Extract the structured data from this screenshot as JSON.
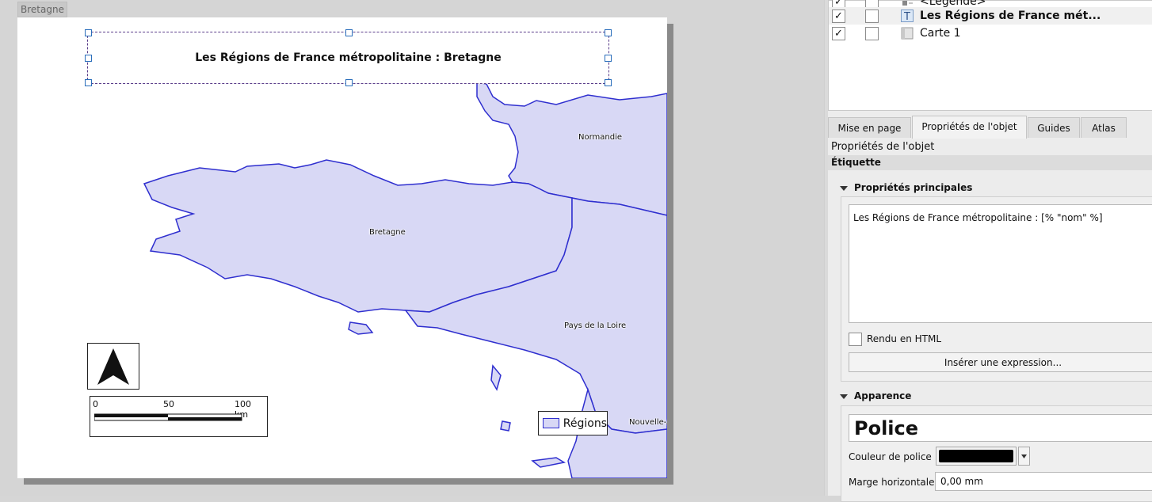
{
  "canvas": {
    "atlas_tag": "Bretagne",
    "title": "Les Régions de France métropolitaine : Bretagne",
    "map_labels": {
      "normandie": "Normandie",
      "bretagne": "Bretagne",
      "pays_de_la_loire": "Pays de la Loire",
      "nouvelle_aquitaine": "Nouvelle-A"
    },
    "scale_bar": {
      "labels": [
        "0",
        "50",
        "100 km"
      ]
    },
    "legend": {
      "label": "Régions"
    },
    "colors": {
      "region_fill": "#d8d8f5",
      "region_stroke": "#2f2fcf"
    }
  },
  "items_panel": {
    "rows": [
      {
        "label": "<Légende>",
        "visible": true,
        "locked": false,
        "icon": "legend-icon"
      },
      {
        "label": "Les Régions de France mét...",
        "visible": true,
        "locked": false,
        "icon": "text-icon",
        "selected": true
      },
      {
        "label": "Carte 1",
        "visible": true,
        "locked": false,
        "icon": "map-icon"
      }
    ]
  },
  "tabs": [
    {
      "label": "Mise en page",
      "active": false
    },
    {
      "label": "Propriétés de l'objet",
      "active": true
    },
    {
      "label": "Guides",
      "active": false
    },
    {
      "label": "Atlas",
      "active": false
    }
  ],
  "properties": {
    "caption": "Propriétés de l'objet",
    "section": "Étiquette",
    "main_group": "Propriétés principales",
    "label_text": "Les Régions de France métropolitaine : [% \"nom\" %]",
    "render_html": "Rendu en HTML",
    "render_html_checked": false,
    "insert_expression": "Insérer une expression...",
    "appearance_group": "Apparence",
    "font_button": "Police",
    "font_color_label": "Couleur de police",
    "font_color": "#000000",
    "margin_label": "Marge horizontale",
    "margin_value": "0,00 mm"
  }
}
